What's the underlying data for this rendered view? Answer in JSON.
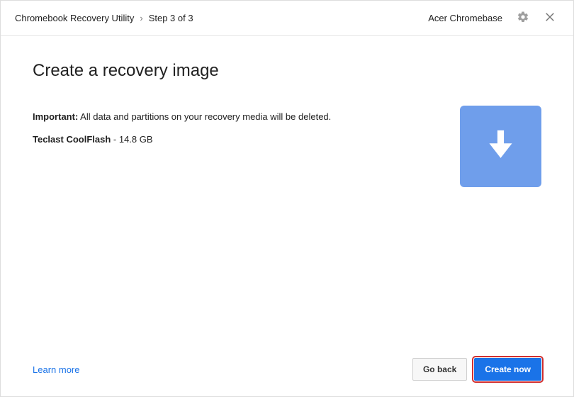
{
  "header": {
    "title": "Chromebook Recovery Utility",
    "separator": "›",
    "step": "Step 3 of 3",
    "device": "Acer Chromebase"
  },
  "main": {
    "heading": "Create a recovery image",
    "important_label": "Important:",
    "important_text": " All data and partitions on your recovery media will be deleted.",
    "media_name": "Teclast CoolFlash",
    "media_size": " - 14.8 GB"
  },
  "footer": {
    "learn_more": "Learn more",
    "go_back": "Go back",
    "create_now": "Create now"
  }
}
